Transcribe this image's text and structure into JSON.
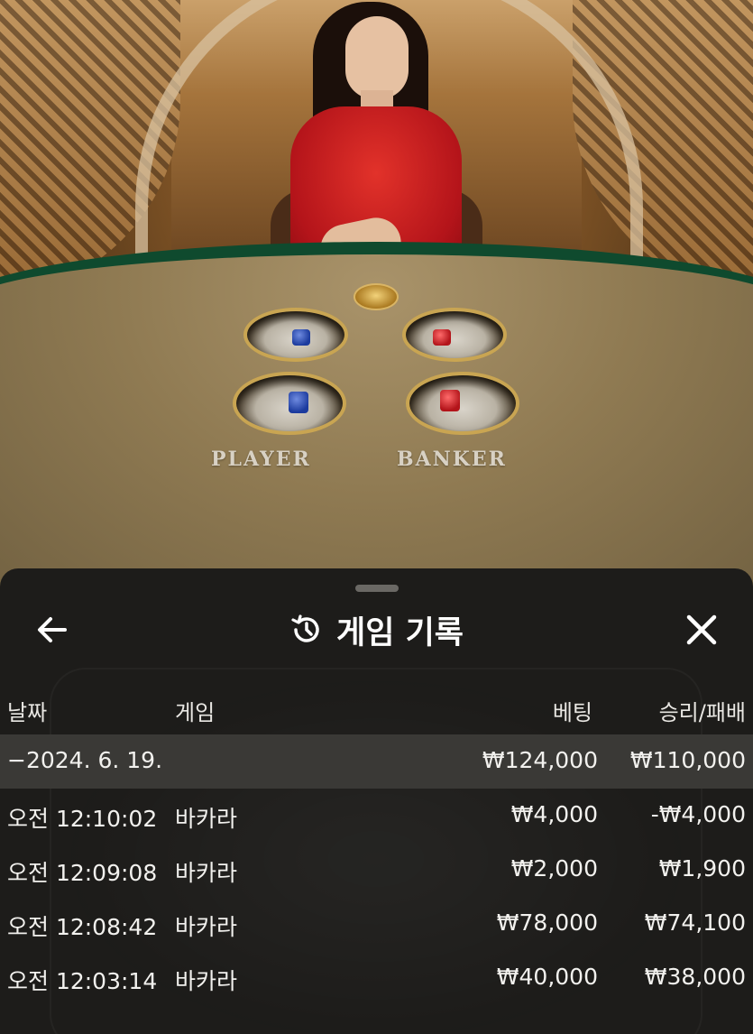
{
  "table": {
    "player_label": "PLAYER",
    "banker_label": "BANKER"
  },
  "history": {
    "title": "게임 기록",
    "icons": {
      "back": "arrow-left-icon",
      "history": "history-clock-icon",
      "close": "close-icon"
    },
    "columns": {
      "date": "날짜",
      "game": "게임",
      "bet": "베팅",
      "result": "승리/패배"
    },
    "group": {
      "date": "−2024. 6. 19.",
      "bet": "₩124,000",
      "result": "₩110,000"
    },
    "rows": [
      {
        "time": "오전 12:10:02",
        "game": "바카라",
        "bet": "₩4,000",
        "result": "-₩4,000"
      },
      {
        "time": "오전 12:09:08",
        "game": "바카라",
        "bet": "₩2,000",
        "result": "₩1,900"
      },
      {
        "time": "오전 12:08:42",
        "game": "바카라",
        "bet": "₩78,000",
        "result": "₩74,100"
      },
      {
        "time": "오전 12:03:14",
        "game": "바카라",
        "bet": "₩40,000",
        "result": "₩38,000"
      }
    ],
    "colors": {
      "sheet_bg": "#1d1c1a",
      "group_row_bg": "#3a3936",
      "text": "#f2f1ee"
    }
  }
}
